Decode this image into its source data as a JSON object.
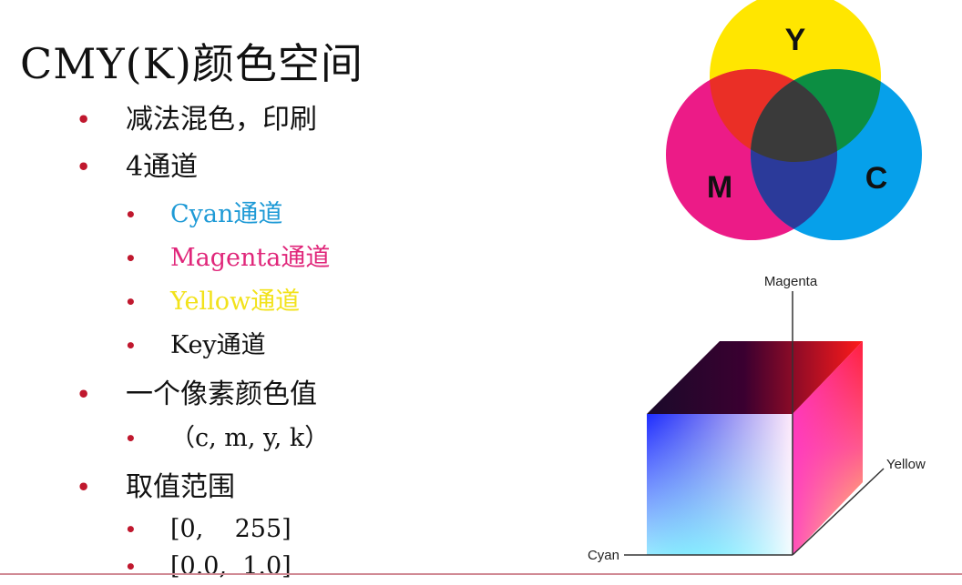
{
  "slide": {
    "title": "CMY(K)颜色空间",
    "bullets": [
      {
        "text": "减法混色，印刷"
      },
      {
        "text": "4通道"
      },
      {
        "text": "Cyan通道",
        "color_word": "Cyan",
        "suffix": "通道"
      },
      {
        "text": "Magenta通道",
        "color_word": "Magenta",
        "suffix": "通道"
      },
      {
        "text": "Yellow通道",
        "color_word": "Yellow",
        "suffix": "通道"
      },
      {
        "text": "Key通道"
      },
      {
        "text": "一个像素颜色值"
      },
      {
        "text": "（c, m, y, k）"
      },
      {
        "text": "取值范围"
      },
      {
        "text": "[0,    255]"
      },
      {
        "text": "[0.0,  1.0]"
      }
    ]
  },
  "venn": {
    "labels": {
      "y": "Y",
      "m": "M",
      "c": "C"
    },
    "colors": {
      "yellow": "#ffe600",
      "magenta": "#ec1b87",
      "cyan": "#06a0ea",
      "red": "#ea2f26",
      "green": "#0c8e42",
      "blue": "#2b3a9a",
      "black": "#3a3a3a"
    }
  },
  "cube": {
    "axis_labels": {
      "magenta": "Magenta",
      "yellow": "Yellow",
      "cyan": "Cyan"
    }
  },
  "colors": {
    "bullet": "#c0182e",
    "cyan_text": "#1e9ad6",
    "magenta_text": "#e0267a",
    "yellow_text": "#f2e21a",
    "rule": "#d08a94"
  }
}
